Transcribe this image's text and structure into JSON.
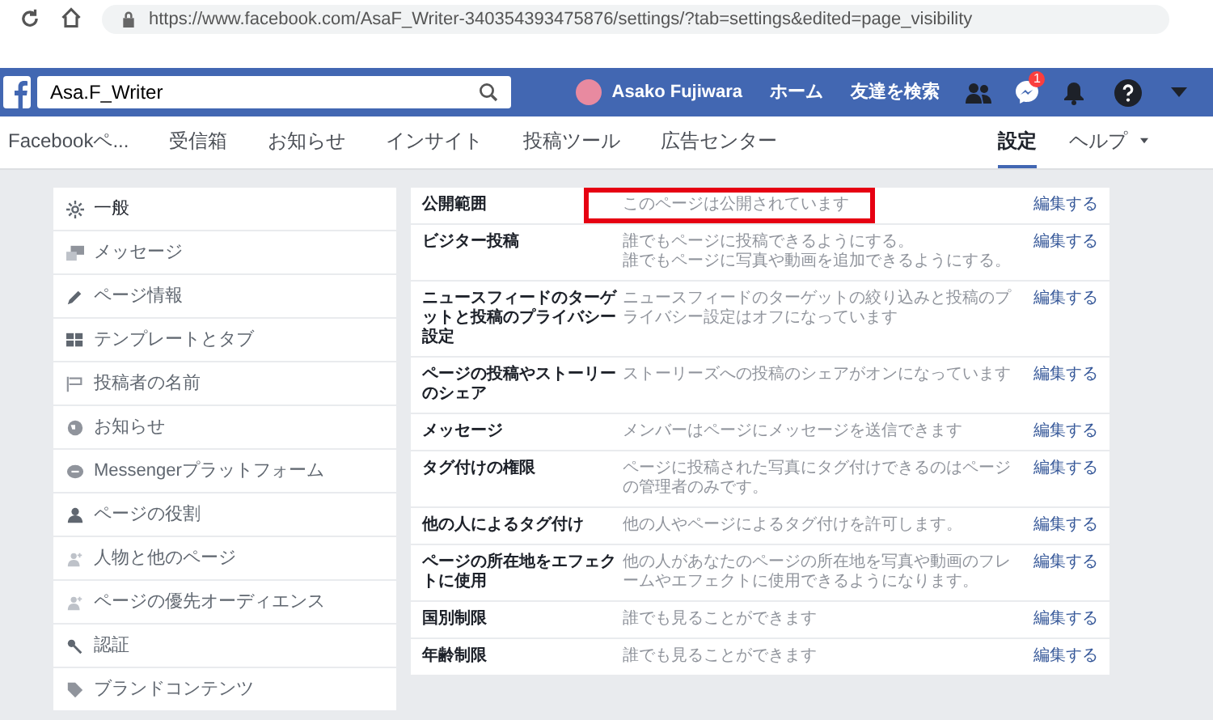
{
  "browser": {
    "url": "https://www.facebook.com/AsaF_Writer-340354393475876/settings/?tab=settings&edited=page_visibility"
  },
  "topbar": {
    "search": {
      "value": "Asa.F_Writer"
    },
    "user": "Asako Fujiwara",
    "links": [
      "ホーム",
      "友達を検索"
    ],
    "messages_badge": "1"
  },
  "page_nav": {
    "tabs": [
      {
        "label": "Facebookペ...",
        "selected": false
      },
      {
        "label": "受信箱",
        "selected": false
      },
      {
        "label": "お知らせ",
        "selected": false
      },
      {
        "label": "インサイト",
        "selected": false
      },
      {
        "label": "投稿ツール",
        "selected": false
      },
      {
        "label": "広告センター",
        "selected": false
      }
    ],
    "right": [
      {
        "label": "設定",
        "selected": true,
        "kind": "tab"
      },
      {
        "label": "ヘルプ",
        "selected": false,
        "kind": "dropdown"
      }
    ]
  },
  "sidebar": {
    "items": [
      {
        "label": "一般",
        "selected": true
      },
      {
        "label": "メッセージ",
        "selected": false
      },
      {
        "label": "ページ情報",
        "selected": false
      },
      {
        "label": "テンプレートとタブ",
        "selected": false
      },
      {
        "label": "投稿者の名前",
        "selected": false
      },
      {
        "label": "お知らせ",
        "selected": false
      },
      {
        "label": "Messengerプラットフォーム",
        "selected": false
      },
      {
        "label": "ページの役割",
        "selected": false
      },
      {
        "label": "人物と他のページ",
        "selected": false
      },
      {
        "label": "ページの優先オーディエンス",
        "selected": false
      },
      {
        "label": "認証",
        "selected": false
      },
      {
        "label": "ブランドコンテンツ",
        "selected": false
      }
    ]
  },
  "settings": {
    "rows": [
      {
        "label": "公開範囲",
        "description": [
          "このページは公開されています"
        ],
        "action": "編集する",
        "highlighted": true
      },
      {
        "label": "ビジター投稿",
        "description": [
          "誰でもページに投稿できるようにする。",
          "誰でもページに写真や動画を追加できるようにする。"
        ],
        "action": "編集する",
        "highlighted": false
      },
      {
        "label": "ニュースフィードのターゲットと投稿のプライバシー設定",
        "description": [
          "ニュースフィードのターゲットの絞り込みと投稿のプライバシー設定はオフになっています"
        ],
        "action": "編集する",
        "highlighted": false
      },
      {
        "label": "ページの投稿やストーリーのシェア",
        "description": [
          "ストーリーズへの投稿のシェアがオンになっています"
        ],
        "action": "編集する",
        "highlighted": false
      },
      {
        "label": "メッセージ",
        "description": [
          "メンバーはページにメッセージを送信できます"
        ],
        "action": "編集する",
        "highlighted": false
      },
      {
        "label": "タグ付けの権限",
        "description": [
          "ページに投稿された写真にタグ付けできるのはページの管理者のみです。"
        ],
        "action": "編集する",
        "highlighted": false
      },
      {
        "label": "他の人によるタグ付け",
        "description": [
          "他の人やページによるタグ付けを許可します。"
        ],
        "action": "編集する",
        "highlighted": false
      },
      {
        "label": "ページの所在地をエフェクトに使用",
        "description": [
          "他の人があなたのページの所在地を写真や動画のフレームやエフェクトに使用できるようになります。"
        ],
        "action": "編集する",
        "highlighted": false
      },
      {
        "label": "国別制限",
        "description": [
          "誰でも見ることができます"
        ],
        "action": "編集する",
        "highlighted": false
      },
      {
        "label": "年齢制限",
        "description": [
          "誰でも見ることができます"
        ],
        "action": "編集する",
        "highlighted": false
      }
    ]
  }
}
